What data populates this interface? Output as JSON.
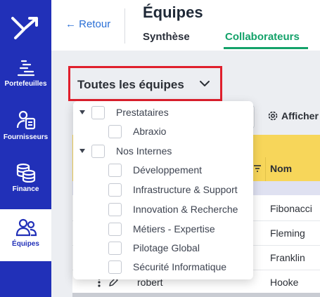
{
  "sidebar": {
    "items": [
      {
        "label": "Portefeuilles",
        "icon": "portfolio-icon",
        "active": false
      },
      {
        "label": "Fournisseurs",
        "icon": "supplier-icon",
        "active": false
      },
      {
        "label": "Finance",
        "icon": "coins-icon",
        "active": false
      },
      {
        "label": "Équipes",
        "icon": "team-icon",
        "active": true
      }
    ]
  },
  "header": {
    "back_label": "← Retour",
    "title": "Équipes",
    "tabs": [
      {
        "label": "Synthèse",
        "active": false
      },
      {
        "label": "Collaborateurs",
        "active": true
      }
    ]
  },
  "team_select": {
    "value": "Toutes les équipes"
  },
  "toolbar": {
    "display_label": "Afficher"
  },
  "table": {
    "header_nom": "Nom",
    "rows": [
      {
        "first": "",
        "nom": "Fibonacci"
      },
      {
        "first": "",
        "nom": "Fleming"
      },
      {
        "first": "",
        "nom": "Franklin"
      },
      {
        "first": "robert",
        "nom": "Hooke"
      }
    ]
  },
  "team_tree": [
    {
      "label": "Prestataires",
      "level": 0,
      "expanded": true,
      "checked": false
    },
    {
      "label": "Abraxio",
      "level": 1,
      "checked": false
    },
    {
      "label": "Nos Internes",
      "level": 0,
      "expanded": true,
      "checked": false
    },
    {
      "label": "Développement",
      "level": 1,
      "checked": false
    },
    {
      "label": "Infrastructure & Support",
      "level": 1,
      "checked": false
    },
    {
      "label": "Innovation & Recherche",
      "level": 1,
      "checked": false
    },
    {
      "label": "Métiers - Expertise",
      "level": 1,
      "checked": false
    },
    {
      "label": "Pilotage Global",
      "level": 1,
      "checked": false
    },
    {
      "label": "Sécurité Informatique",
      "level": 1,
      "checked": false
    }
  ],
  "colors": {
    "sidebar": "#2130b8",
    "accent_green": "#14a26a",
    "link_blue": "#2a6fd6",
    "highlight_red": "#e01f2c",
    "table_header": "#f7d65a"
  }
}
